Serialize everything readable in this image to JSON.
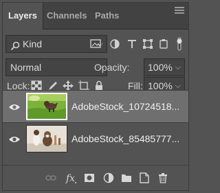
{
  "tabs": [
    {
      "label": "Layers"
    },
    {
      "label": "Channels"
    },
    {
      "label": "Paths"
    }
  ],
  "filter": {
    "kind_label": "Kind"
  },
  "blend": {
    "mode": "Normal",
    "opacity_label": "Opacity:",
    "opacity_value": "100%"
  },
  "lock": {
    "label": "Lock:",
    "fill_label": "Fill:",
    "fill_value": "100%"
  },
  "layers": [
    {
      "name": "AdobeStock_10724518...",
      "selected": true,
      "thumb": "green-meadow-dog"
    },
    {
      "name": "AdobeStock_85485777...",
      "selected": false,
      "thumb": "white-wall-dog"
    }
  ],
  "bottom_icons": [
    "link-icon",
    "fx-icon",
    "mask-icon",
    "adjustment-icon",
    "folder-icon",
    "new-layer-icon",
    "trash-icon"
  ],
  "colors": {
    "panel": "#535353",
    "tabbar": "#424242",
    "selected_row": "#6f6f6f",
    "field": "#444444"
  }
}
